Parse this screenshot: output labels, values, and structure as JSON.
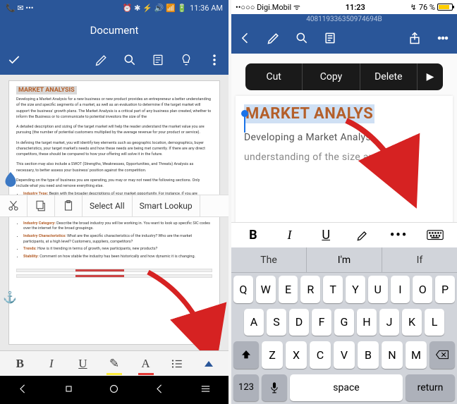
{
  "android": {
    "status": {
      "carrier": "📞 ✉ •••",
      "icons": "⏰ ✱ ⚡ 🔊 📶 🔋",
      "time": "11:36 AM"
    },
    "title": "Document",
    "doc": {
      "heading": "MARKET ANALYSIS",
      "p1": "Developing a Market Analysis for a new business or new product provides an entrepreneur a better understanding of the size and specific segments of a market, as well as an evaluation to determine if the target market will support the business' growth plans. The Market Analysis is a critical part of any business plan created, whether to inform the Business or to communicate to potential investors the size of the",
      "p2": "A detailed description and sizing of the target market will help the reader understand the market value you are pursuing (the number of potential customers multiplied by the average revenue for your product or service).",
      "p3": "In defining the target market, you will identify key elements such as geographic location, demographics, buyer characteristics, your target market's needs and how these needs are being met currently. If there are any direct competitors, these should be compared to how your offering will solve it in the future.",
      "p4": "This section may also include a SWOT (Strengths, Weaknesses, Opportunities, and Threats) Analysis as necessary, to better assess your business' position against the competition.",
      "p5": "Depending on the type of business you are operating, you may or may not need the following sections. Only include what you need and remove everything else.",
      "li1": {
        "label": "Industry Type:",
        "text": "Begin with the broader descriptions of your market opportunity. For instance, if you are planning to open a jewelry store, the industry type would be retail sales, but only locally versus if you sold online. Within the retail jewelry industry, globally, revenues are expected to exceed $250 billion by 2020, but your local jewelry store will have a much smaller market. Identify the number of families or customers in your local geography that might fit into your demographic target group."
      },
      "li2": {
        "label": "Industry Category:",
        "text": "Describe the broad industry you will be working in. You want to look up specific SIC codes over the internet for the broad groupings."
      },
      "li3": {
        "label": "Industry Characteristics:",
        "text": "What are the specific characteristics of the industry? Who are the market participants, at a high level? Customers, suppliers, competitors?"
      },
      "li4": {
        "label": "Trends:",
        "text": "How is it trending in terms of growth, new participants, new products?"
      },
      "li5": {
        "label": "Stability:",
        "text": "Comment on how stable the industry has been historically and how dynamic it is changing."
      }
    },
    "context": {
      "select_all": "Select All",
      "smart_lookup": "Smart Lookup"
    },
    "format": {
      "bold": "B",
      "italic": "I",
      "underline": "U",
      "hl": "✎",
      "fc": "A"
    }
  },
  "ios": {
    "status": {
      "carrier": "••○○○ Digi.Mobil",
      "wifi": "ᯤ",
      "time": "11:23",
      "battery_pct": "76 %",
      "battery_sym": "↯"
    },
    "filenum": "408119336350974694B",
    "doc": {
      "heading": "MARKET ANALYS",
      "p1": "Developing a Market Analys",
      "p2": "understanding of the size an"
    },
    "context": {
      "cut": "Cut",
      "copy": "Copy",
      "delete": "Delete",
      "more": "▶"
    },
    "format": {
      "bold": "B",
      "italic": "I",
      "underline": "U",
      "dots": "•••"
    },
    "predictions": [
      "The",
      "I'm",
      "If"
    ],
    "keys": {
      "r1": [
        "Q",
        "W",
        "E",
        "R",
        "T",
        "Y",
        "U",
        "I",
        "O",
        "P"
      ],
      "r2": [
        "A",
        "S",
        "D",
        "F",
        "G",
        "H",
        "J",
        "K",
        "L"
      ],
      "r3": [
        "Z",
        "X",
        "C",
        "V",
        "B",
        "N",
        "M"
      ],
      "bottom": {
        "num": "123",
        "space": "space",
        "ret": "return"
      }
    }
  }
}
